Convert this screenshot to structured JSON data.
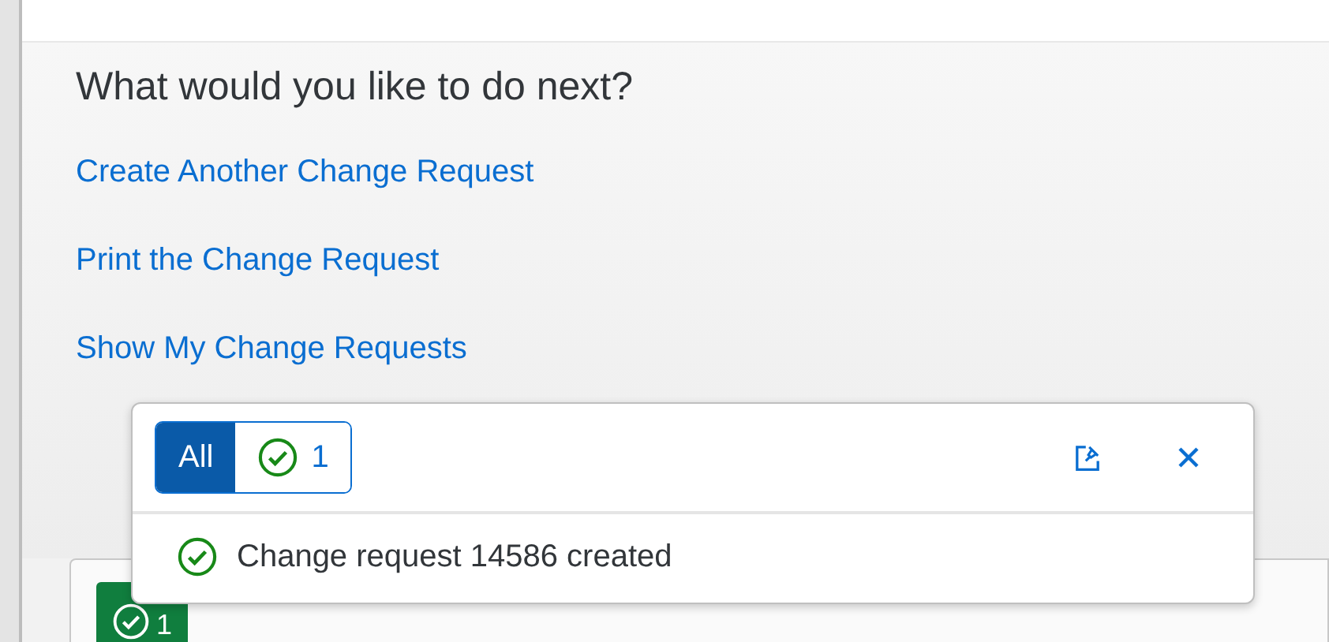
{
  "heading": "What would you like to do next?",
  "links": [
    "Create Another Change Request",
    "Print the Change Request",
    "Show My Change Requests"
  ],
  "message_popover": {
    "filters": [
      {
        "kind": "all",
        "label": "All",
        "selected": true
      },
      {
        "kind": "success",
        "label": "1",
        "selected": false
      }
    ],
    "messages": [
      {
        "kind": "success",
        "text": "Change request 14586 created"
      }
    ]
  },
  "footer": {
    "message_count": "1"
  }
}
